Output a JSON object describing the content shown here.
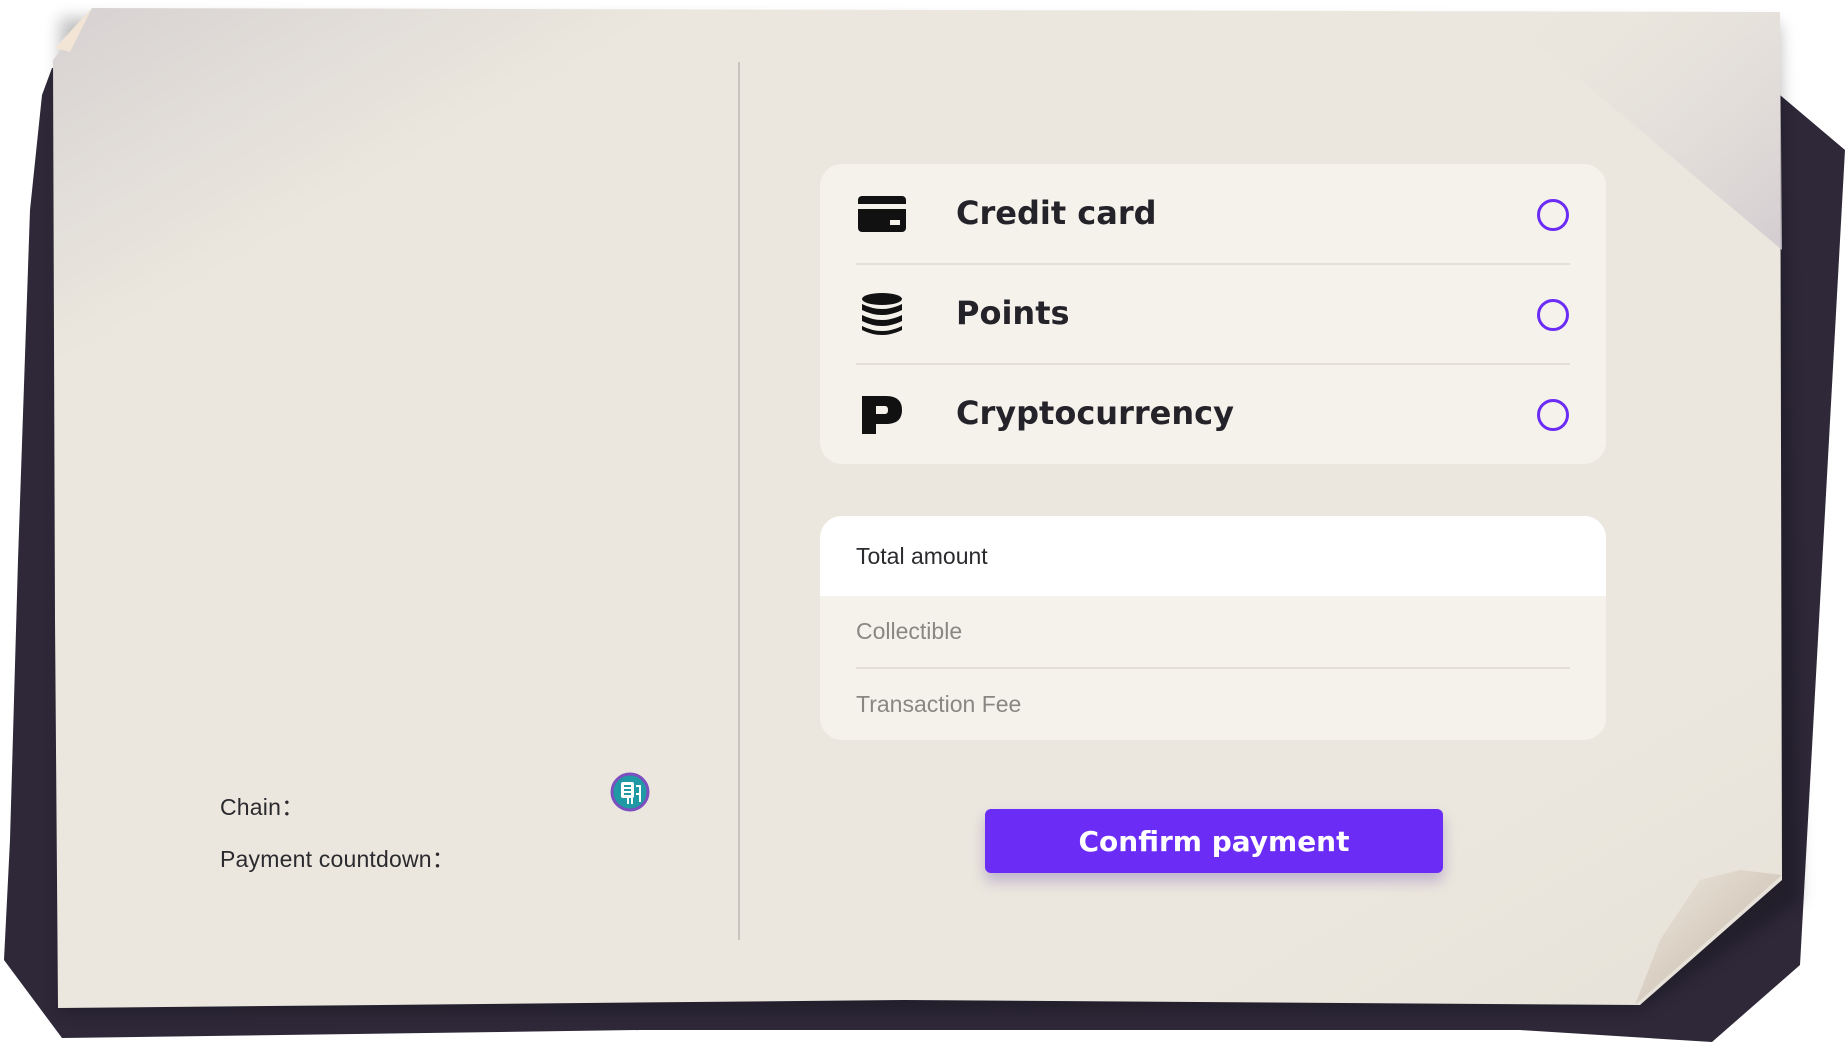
{
  "payment_methods": [
    {
      "label": "Credit card",
      "icon": "credit-card-icon"
    },
    {
      "label": "Points",
      "icon": "coin-stack-icon"
    },
    {
      "label": "Cryptocurrency",
      "icon": "p-letter-icon"
    }
  ],
  "summary": {
    "title": "Total amount",
    "collectible_label": "Collectible",
    "fee_label": "Transaction Fee"
  },
  "left_info": {
    "chain_label": "Chain：",
    "countdown_label": "Payment countdown：",
    "chain_icon": "chain-network-icon"
  },
  "actions": {
    "confirm_label": "Confirm payment"
  },
  "colors": {
    "accent": "#6b2cf5",
    "paper": "#ebe7de",
    "panel": "#f5f2ec",
    "backing": "#2e2839"
  }
}
